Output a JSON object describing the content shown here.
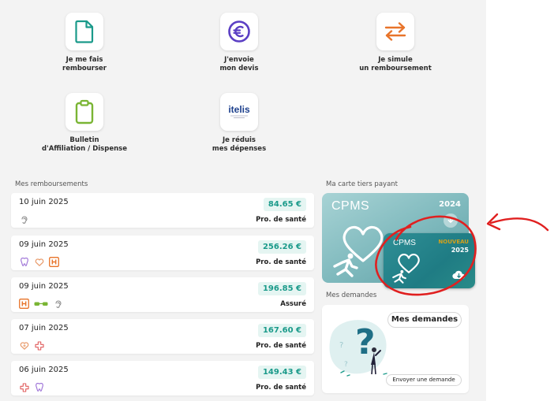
{
  "actions": [
    {
      "label": "Je me fais\nrembourser",
      "icon": "document-icon"
    },
    {
      "label": "J'envoie\nmon devis",
      "icon": "euro-icon"
    },
    {
      "label": "Je simule\nun remboursement",
      "icon": "transfer-arrows-icon"
    },
    {
      "label": "Bulletin\nd'Affiliation / Dispense",
      "icon": "clipboard-icon"
    },
    {
      "label": "Je réduis\nmes dépenses",
      "icon": "itelis-logo",
      "logo_text": "itelis"
    }
  ],
  "reimbursements": {
    "title": "Mes remboursements",
    "items": [
      {
        "date": "10 juin 2025",
        "amount": "84.65 €",
        "who": "Pro. de santé",
        "icons": [
          "ear-icon"
        ]
      },
      {
        "date": "09 juin 2025",
        "amount": "256.26 €",
        "who": "Pro. de santé",
        "icons": [
          "tooth-icon",
          "heart-icon",
          "hospital-icon"
        ]
      },
      {
        "date": "09 juin 2025",
        "amount": "196.85 €",
        "who": "Assuré",
        "icons": [
          "hospital-icon",
          "glasses-icon",
          "ear-icon"
        ]
      },
      {
        "date": "07 juin 2025",
        "amount": "167.60 €",
        "who": "Pro. de santé",
        "icons": [
          "heart-plus-icon",
          "cross-icon"
        ]
      },
      {
        "date": "06 juin 2025",
        "amount": "149.43 €",
        "who": "Pro. de santé",
        "icons": [
          "cross-icon",
          "tooth-icon"
        ]
      }
    ]
  },
  "tiers_payant": {
    "title": "Ma carte tiers payant",
    "card_2024": {
      "brand": "CPMS",
      "year": "2024"
    },
    "card_2025": {
      "brand": "CPMS",
      "badge": "NOUVEAU",
      "year": "2025"
    }
  },
  "demandes": {
    "title": "Mes demandes",
    "button_label": "Mes demandes",
    "send_label": "Envoyer une demande"
  },
  "colors": {
    "teal": "#1a9a8a",
    "amount_bg": "#e5f5f2",
    "orange": "#e8742a",
    "purple": "#5b3fc4",
    "green": "#7ab534",
    "pink": "#e0527a",
    "annotation_red": "#e02020"
  }
}
